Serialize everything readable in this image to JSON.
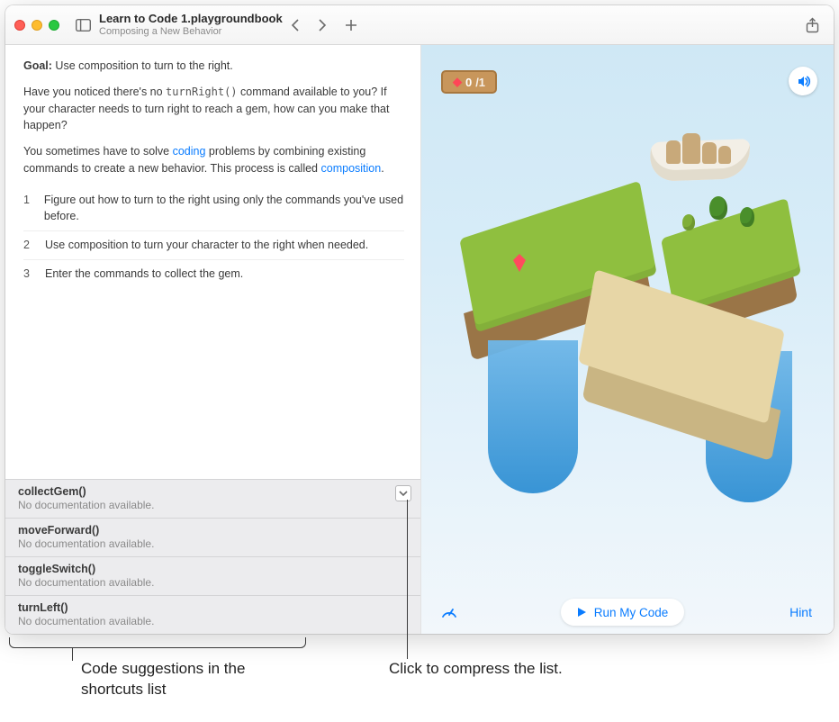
{
  "titlebar": {
    "title": "Learn to Code 1.playgroundbook",
    "subtitle": "Composing a New Behavior"
  },
  "instructions": {
    "goal_label": "Goal:",
    "goal_text": " Use composition to turn to the right.",
    "p2_a": "Have you noticed there's no ",
    "p2_code": "turnRight()",
    "p2_b": " command available to you? If your character needs to turn right to reach a gem, how can you make that happen?",
    "p3_a": "You sometimes have to solve ",
    "p3_link1": "coding",
    "p3_b": " problems by combining existing commands to create a new behavior. This process is called ",
    "p3_link2": "composition",
    "p3_c": "."
  },
  "steps": [
    "Figure out how to turn to the right using only the commands you've used before.",
    "Use composition to turn your character to the right when needed.",
    "Enter the commands to collect the gem."
  ],
  "shortcuts": {
    "no_doc": "No documentation available.",
    "items": [
      {
        "name": "collectGem()"
      },
      {
        "name": "moveForward()"
      },
      {
        "name": "toggleSwitch()"
      },
      {
        "name": "turnLeft()"
      }
    ]
  },
  "scene": {
    "gem_count": "0",
    "gem_total": "/1"
  },
  "controls": {
    "run": "Run My Code",
    "hint": "Hint"
  },
  "callouts": {
    "left": "Code suggestions in the shortcuts list",
    "right": "Click to compress the list."
  }
}
